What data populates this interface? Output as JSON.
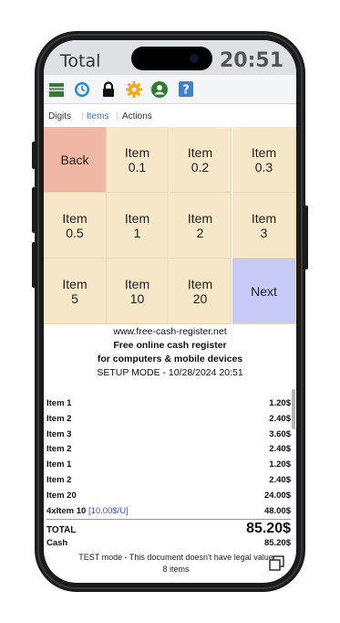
{
  "titlebar": {
    "title": "Total",
    "time": "20:51"
  },
  "toolbar_icons": [
    "register-icon",
    "clock-icon",
    "lock-icon",
    "settings-gear-icon",
    "user-icon",
    "help-icon"
  ],
  "tabs": [
    {
      "label": "Digits",
      "active": false
    },
    {
      "label": "Items",
      "active": true
    },
    {
      "label": "Actions",
      "active": false
    }
  ],
  "keypad": {
    "back": "Back",
    "next": "Next",
    "items": [
      {
        "line1": "Item",
        "line2": "0.1"
      },
      {
        "line1": "Item",
        "line2": "0.2"
      },
      {
        "line1": "Item",
        "line2": "0.3"
      },
      {
        "line1": "Item",
        "line2": "0.5"
      },
      {
        "line1": "Item",
        "line2": "1"
      },
      {
        "line1": "Item",
        "line2": "2"
      },
      {
        "line1": "Item",
        "line2": "3"
      },
      {
        "line1": "Item",
        "line2": "5"
      },
      {
        "line1": "Item",
        "line2": "10"
      },
      {
        "line1": "Item",
        "line2": "20"
      }
    ]
  },
  "receipt": {
    "site": "www.free-cash-register.net",
    "headline": "Free online cash register",
    "subline": "for computers & mobile devices",
    "mode": "SETUP MODE - 10/28/2024 20:51",
    "lines": [
      {
        "name": "Item 1",
        "unit": "",
        "price": "1.20$"
      },
      {
        "name": "Item 2",
        "unit": "",
        "price": "2.40$"
      },
      {
        "name": "Item 3",
        "unit": "",
        "price": "3.60$"
      },
      {
        "name": "Item 2",
        "unit": "",
        "price": "2.40$"
      },
      {
        "name": "Item 1",
        "unit": "",
        "price": "1.20$"
      },
      {
        "name": "Item 2",
        "unit": "",
        "price": "2.40$"
      },
      {
        "name": "Item 20",
        "unit": "",
        "price": "24.00$"
      },
      {
        "name": "4xItem 10",
        "unit": "[10.00$/U]",
        "price": "48.00$"
      }
    ],
    "total_label": "TOTAL",
    "total_value": "85.20$",
    "cash_label": "Cash",
    "cash_value": "85.20$",
    "footer_note": "TEST mode - This document doesn't have legal value",
    "item_count": "8 items"
  },
  "colors": {
    "keypad_bg": "#f6e7c9",
    "back_bg": "#f0b8a4",
    "next_bg": "#c7c9f7",
    "active_tab": "#3a6fc0",
    "unit_price": "#3a4fd0"
  }
}
